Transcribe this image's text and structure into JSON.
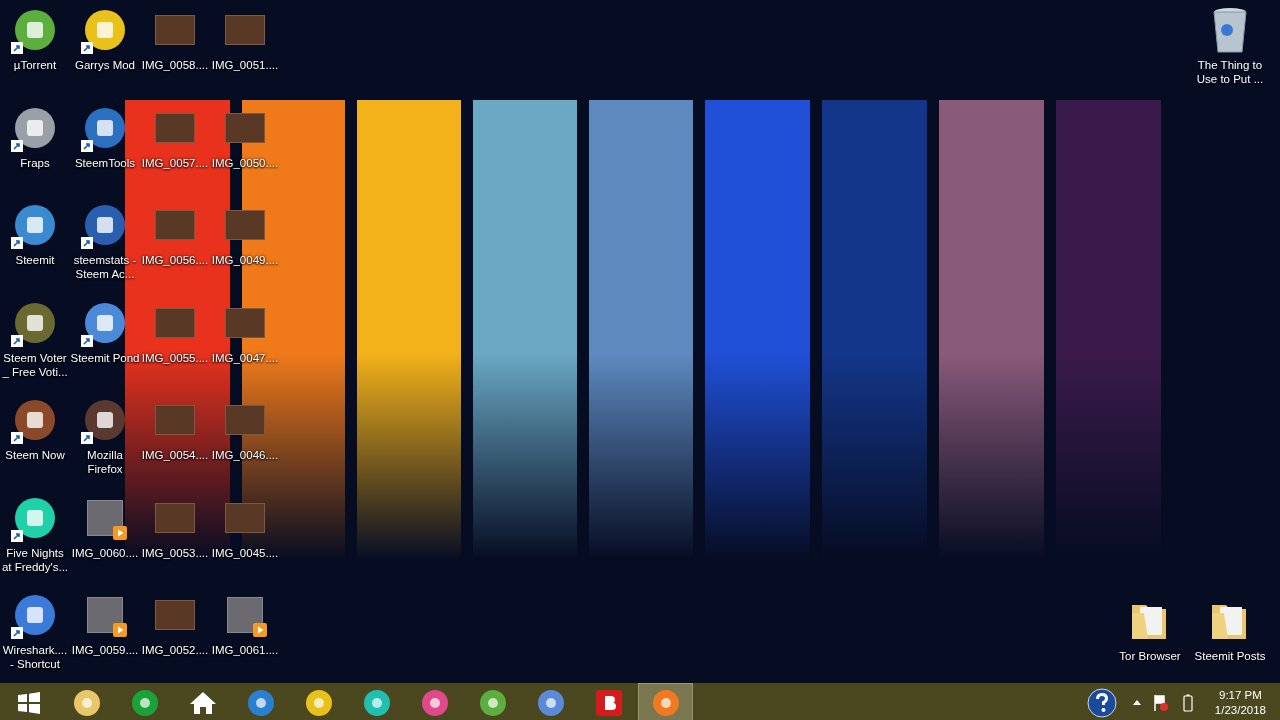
{
  "desktop": {
    "left_icons": [
      {
        "label": "µTorrent",
        "kind": "shortcut"
      },
      {
        "label": "Garrys Mod",
        "kind": "shortcut"
      },
      {
        "label": "IMG_0058....",
        "kind": "photo"
      },
      {
        "label": "IMG_0051....",
        "kind": "photo"
      },
      {
        "label": "Fraps",
        "kind": "shortcut"
      },
      {
        "label": "SteemTools",
        "kind": "shortcut"
      },
      {
        "label": "IMG_0057....",
        "kind": "photo"
      },
      {
        "label": "IMG_0050....",
        "kind": "photo"
      },
      {
        "label": "Steemit",
        "kind": "shortcut"
      },
      {
        "label": "steemstats - Steem Ac...",
        "kind": "shortcut"
      },
      {
        "label": "IMG_0056....",
        "kind": "photo"
      },
      {
        "label": "IMG_0049....",
        "kind": "photo"
      },
      {
        "label": "Steem Voter _ Free Voti...",
        "kind": "shortcut"
      },
      {
        "label": "Steemit Pond",
        "kind": "shortcut"
      },
      {
        "label": "IMG_0055....",
        "kind": "photo"
      },
      {
        "label": "IMG_0047....",
        "kind": "photo"
      },
      {
        "label": "Steem Now",
        "kind": "shortcut"
      },
      {
        "label": "Mozilla Firefox",
        "kind": "shortcut"
      },
      {
        "label": "IMG_0054....",
        "kind": "photo"
      },
      {
        "label": "IMG_0046....",
        "kind": "photo"
      },
      {
        "label": "Five Nights at Freddy's...",
        "kind": "shortcut"
      },
      {
        "label": "IMG_0060....",
        "kind": "video"
      },
      {
        "label": "IMG_0053....",
        "kind": "photo"
      },
      {
        "label": "IMG_0045....",
        "kind": "photo"
      },
      {
        "label": "Wireshark.... - Shortcut",
        "kind": "shortcut"
      },
      {
        "label": "IMG_0059....",
        "kind": "video"
      },
      {
        "label": "IMG_0052....",
        "kind": "photo"
      },
      {
        "label": "IMG_0061....",
        "kind": "video"
      }
    ],
    "recycle_bin": {
      "label": "The Thing to Use to Put ..."
    },
    "right_icons": [
      {
        "label": "Tor Browser",
        "kind": "folder"
      },
      {
        "label": "Steemit Posts",
        "kind": "folder"
      }
    ]
  },
  "taskbar": {
    "buttons": [
      {
        "selected": false
      },
      {
        "selected": false
      },
      {
        "selected": false
      },
      {
        "selected": false
      },
      {
        "selected": false
      },
      {
        "selected": false
      },
      {
        "selected": false
      },
      {
        "selected": false
      },
      {
        "selected": false
      },
      {
        "selected": false
      },
      {
        "selected": false
      },
      {
        "selected": true
      }
    ],
    "tray": {
      "time": "9:17 PM",
      "date": "1/23/2018"
    }
  }
}
